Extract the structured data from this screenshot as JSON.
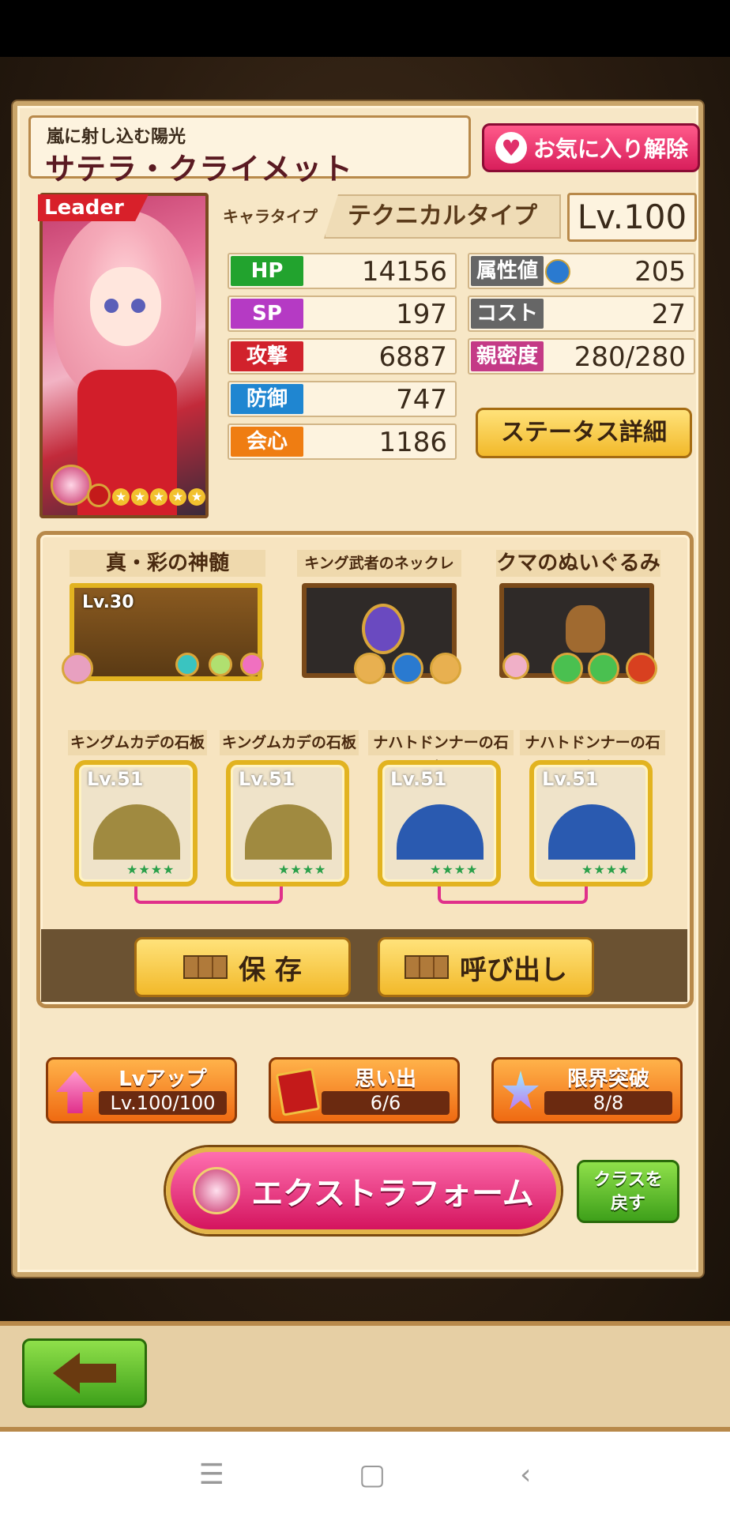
{
  "character": {
    "subtitle": "嵐に射し込む陽光",
    "name": "サテラ・クライメット",
    "leader_badge": "Leader",
    "rarity_stars": 5
  },
  "favorite_button": {
    "label": "お気に入り解除",
    "icon": "heart-icon"
  },
  "type": {
    "label": "キャラタイプ",
    "value": "テクニカルタイプ"
  },
  "level": "Lv.100",
  "stats_left": [
    {
      "label": "HP",
      "value": "14156",
      "color": "#22a32e"
    },
    {
      "label": "SP",
      "value": "197",
      "color": "#b53ac4"
    },
    {
      "label": "攻撃",
      "value": "6887",
      "color": "#d1222c"
    },
    {
      "label": "防御",
      "value": "747",
      "color": "#1f86d1"
    },
    {
      "label": "会心",
      "value": "1186",
      "color": "#ef7d12"
    }
  ],
  "stats_right": [
    {
      "label": "属性値",
      "value": "205",
      "color": "#666666",
      "icon": "water-icon"
    },
    {
      "label": "コスト",
      "value": "27",
      "color": "#666666"
    },
    {
      "label": "親密度",
      "value": "280/280",
      "color": "#c43a86"
    }
  ],
  "status_detail_button": "ステータス詳細",
  "equipment": [
    {
      "name": "真・彩の神髄",
      "level": "Lv.30"
    },
    {
      "name": "キング武者のネックレス"
    },
    {
      "name": "クマのぬいぐるみ"
    }
  ],
  "slabs": [
    {
      "name": "キングムカデの石板",
      "level": "Lv.51",
      "color": "gold"
    },
    {
      "name": "キングムカデの石板",
      "level": "Lv.51",
      "color": "gold"
    },
    {
      "name": "ナハトドンナーの石板",
      "level": "Lv.51",
      "color": "blue"
    },
    {
      "name": "ナハトドンナーの石板",
      "level": "Lv.51",
      "color": "blue"
    }
  ],
  "save_button": "保 存",
  "load_button": "呼び出し",
  "actions": {
    "lvup": {
      "title": "Lvアップ",
      "value": "Lv.100/100"
    },
    "memories": {
      "title": "思い出",
      "value": "6/6"
    },
    "limit_break": {
      "title": "限界突破",
      "value": "8/8"
    }
  },
  "extra_form_button": "エクストラフォーム",
  "class_revert_button": {
    "line1": "クラスを",
    "line2": "戻す"
  },
  "nav": {
    "menu": "☰",
    "home": "▢",
    "back": "‹"
  }
}
